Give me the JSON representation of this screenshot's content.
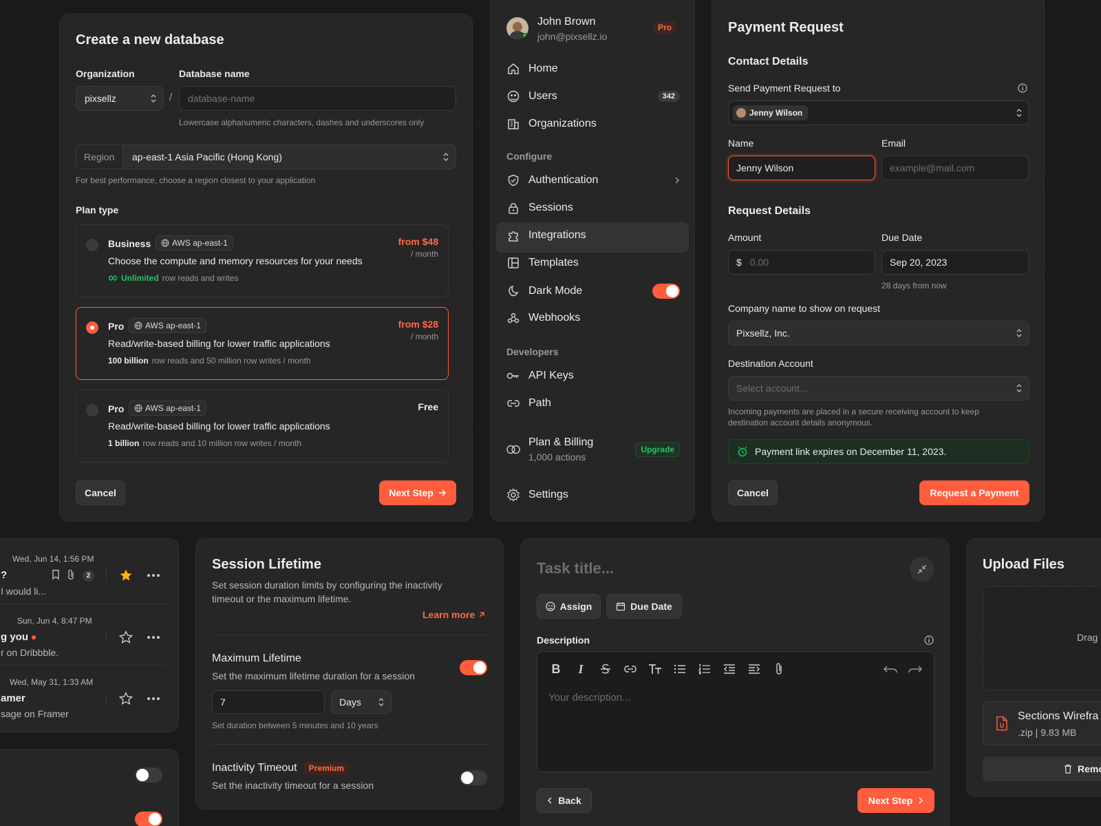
{
  "create_db": {
    "title": "Create a new database",
    "org_label": "Organization",
    "org_value": "pixsellz",
    "db_label": "Database name",
    "db_placeholder": "database-name",
    "slash": "/",
    "db_hint": "Lowercase alphanumeric characters, dashes and underscores only",
    "region_prefix": "Region",
    "region_value": "ap-east-1 Asia Pacific (Hong Kong)",
    "region_hint": "For best performance, choose a region closest to your application",
    "plan_label": "Plan type",
    "plans": [
      {
        "name": "Business",
        "tag": "AWS ap-east-1",
        "price": "from $48",
        "per": "/ month",
        "desc": "Choose the compute and memory resources for your needs",
        "meta_strong": "Unlimited",
        "meta": "row reads and writes",
        "selected": false
      },
      {
        "name": "Pro",
        "tag": "AWS ap-east-1",
        "price": "from $28",
        "per": "/ month",
        "desc": "Read/write-based billing for lower traffic applications",
        "meta_strong": "100 billion",
        "meta": "row reads and 50 million row writes / month",
        "selected": true
      },
      {
        "name": "Pro",
        "tag": "AWS ap-east-1",
        "price": "Free",
        "per": "",
        "desc": "Read/write-based billing for lower traffic applications",
        "meta_strong": "1 billion",
        "meta": "row reads and 10 million row writes / month",
        "selected": false
      }
    ],
    "cancel": "Cancel",
    "next": "Next Step"
  },
  "sidebar": {
    "user_name": "John Brown",
    "user_email": "john@pixsellz.io",
    "badge": "Pro",
    "main": [
      {
        "label": "Home",
        "icon": "home-icon"
      },
      {
        "label": "Users",
        "icon": "users-icon",
        "count": "342"
      },
      {
        "label": "Organizations",
        "icon": "building-icon"
      }
    ],
    "configure_label": "Configure",
    "configure": [
      {
        "label": "Authentication",
        "icon": "shield-icon"
      },
      {
        "label": "Sessions",
        "icon": "lock-icon"
      },
      {
        "label": "Integrations",
        "icon": "puzzle-icon"
      },
      {
        "label": "Templates",
        "icon": "layout-icon"
      },
      {
        "label": "Dark Mode",
        "icon": "moon-icon"
      },
      {
        "label": "Webhooks",
        "icon": "webhook-icon"
      }
    ],
    "developers_label": "Developers",
    "developers": [
      {
        "label": "API Keys",
        "icon": "key-icon"
      },
      {
        "label": "Path",
        "icon": "link-icon"
      }
    ],
    "billing_label": "Plan & Billing",
    "billing_sub": "1,000 actions",
    "upgrade": "Upgrade",
    "settings": "Settings",
    "dark_mode_on": true
  },
  "payment": {
    "title": "Payment Request",
    "contact_heading": "Contact Details",
    "send_to_label": "Send Payment Request to",
    "send_to_value": "Jenny Wilson",
    "name_label": "Name",
    "name_value": "Jenny Wilson",
    "email_label": "Email",
    "email_placeholder": "example@mail.com",
    "request_heading": "Request Details",
    "amount_label": "Amount",
    "currency": "$",
    "amount_placeholder": "0.00",
    "due_label": "Due Date",
    "due_value": "Sep 20, 2023",
    "due_hint": "28 days from now",
    "company_label": "Company name to show on request",
    "company_value": "Pixsellz, Inc.",
    "dest_label": "Destination Account",
    "dest_placeholder": "Select account...",
    "dest_hint": "Incoming payments are placed in a secure receiving account to keep destination account details anonymous.",
    "expiry": "Payment link expires on December 11, 2023.",
    "cancel": "Cancel",
    "submit": "Request a Payment"
  },
  "inbox": {
    "items": [
      {
        "date": "Wed, Jun 14, 1:56 PM",
        "title": "?",
        "preview": "I would li...",
        "count": "2",
        "starred": true
      },
      {
        "date": "Sun, Jun 4, 8:47 PM",
        "title": "g you",
        "preview": "r on Dribbble.",
        "starred": false
      },
      {
        "date": "Wed, May 31, 1:33 AM",
        "title": "amer",
        "preview": "sage on Framer",
        "starred": false
      }
    ]
  },
  "session": {
    "title": "Session Lifetime",
    "desc": "Set session duration limits by configuring the inactivity timeout or the maximum lifetime.",
    "learn_more": "Learn more",
    "max_title": "Maximum Lifetime",
    "max_desc": "Set the maximum lifetime duration for a session",
    "max_value": "7",
    "unit": "Days",
    "duration_hint": "Set duration between 5 minutes and 10 years",
    "inactivity_title": "Inactivity Timeout",
    "premium": "Premium",
    "inactivity_desc": "Set the inactivity timeout for a session",
    "max_on": true,
    "inactivity_on": false
  },
  "task": {
    "title_placeholder": "Task title...",
    "assign": "Assign",
    "due": "Due Date",
    "desc_label": "Description",
    "desc_placeholder": "Your description...",
    "back": "Back",
    "next": "Next Step"
  },
  "upload": {
    "title": "Upload Files",
    "drop_text": "Drag",
    "file_name": "Sections Wirefra",
    "file_meta": ".zip | 9.83 MB",
    "remove": "Remo"
  },
  "colors": {
    "accent": "#ff5d3d",
    "bg": "#1a1a1a",
    "card": "#262626",
    "success": "#22c55e"
  }
}
